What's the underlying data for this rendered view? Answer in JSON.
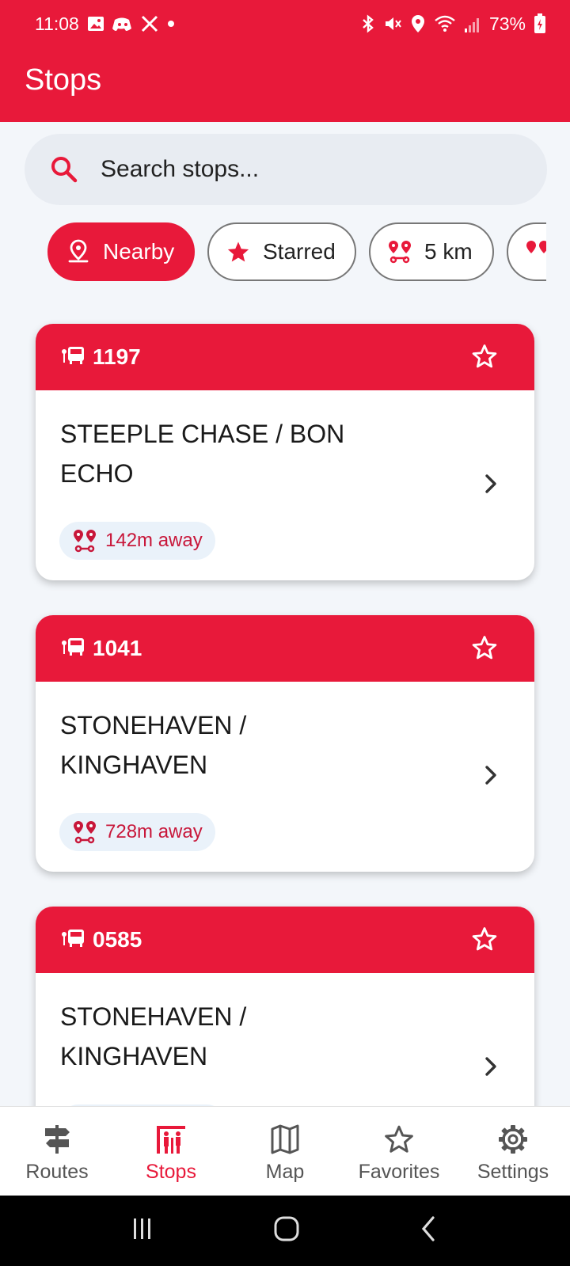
{
  "status_bar": {
    "time": "11:08",
    "battery": "73%"
  },
  "app_bar": {
    "title": "Stops"
  },
  "search": {
    "placeholder": "Search stops..."
  },
  "filters": [
    {
      "label": "Nearby",
      "active": true
    },
    {
      "label": "Starred",
      "active": false
    },
    {
      "label": "5 km",
      "active": false
    }
  ],
  "stops": [
    {
      "code": "1197",
      "name": "STEEPLE CHASE / BON ECHO",
      "distance": "142m away"
    },
    {
      "code": "1041",
      "name": "STONEHAVEN / KINGHAVEN",
      "distance": "728m away"
    },
    {
      "code": "0585",
      "name": "STONEHAVEN / KINGHAVEN",
      "distance": ""
    }
  ],
  "bottom_nav": [
    {
      "label": "Routes",
      "icon": "signpost-icon",
      "active": false
    },
    {
      "label": "Stops",
      "icon": "bus-stop-icon",
      "active": true
    },
    {
      "label": "Map",
      "icon": "map-icon",
      "active": false
    },
    {
      "label": "Favorites",
      "icon": "star-outline-icon",
      "active": false
    },
    {
      "label": "Settings",
      "icon": "gear-icon",
      "active": false
    }
  ],
  "colors": {
    "accent": "#E8193A",
    "background": "#F3F6FA",
    "distance_chip_bg": "#EAF2FA"
  }
}
